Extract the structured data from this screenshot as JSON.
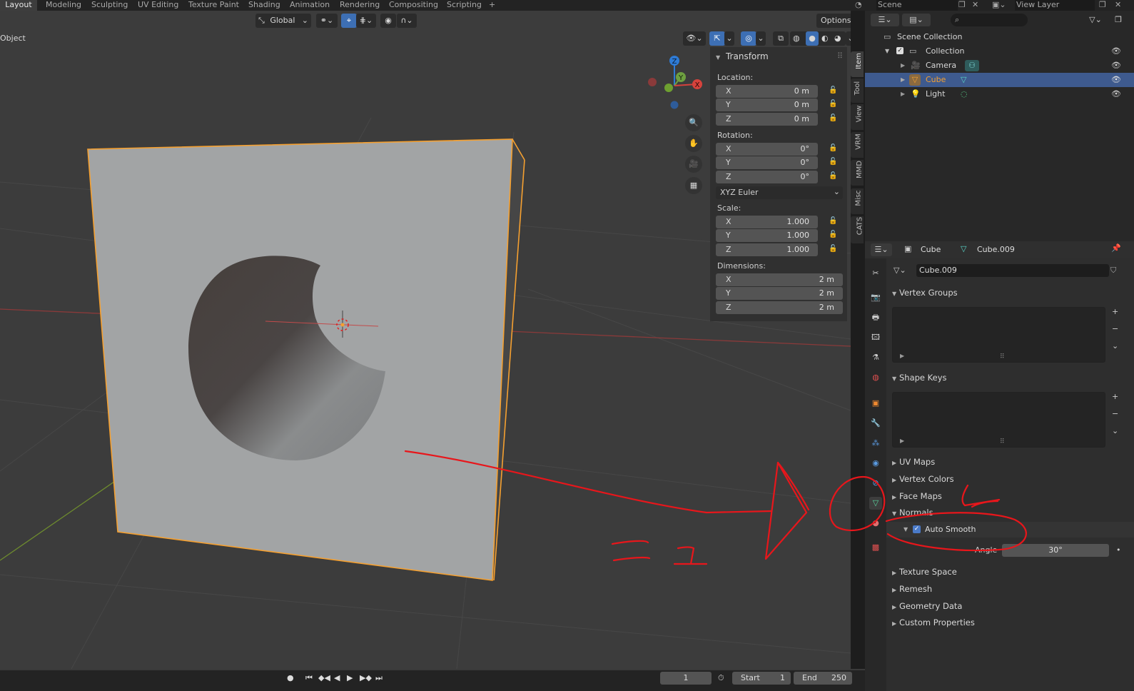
{
  "workspace_tabs": [
    "Layout",
    "Modeling",
    "Sculpting",
    "UV Editing",
    "Texture Paint",
    "Shading",
    "Animation",
    "Rendering",
    "Compositing",
    "Scripting"
  ],
  "add_tab_label": "+",
  "scene_label": "Scene",
  "view_layer_label": "View Layer",
  "viewport": {
    "mode_label": "Object",
    "orientation_label": "Global",
    "options_label": "Options",
    "gizmo_labels": {
      "z": "Z",
      "y": "Y",
      "x": "X"
    }
  },
  "npanel": {
    "title": "Transform",
    "location_label": "Location:",
    "location": [
      {
        "axis": "X",
        "value": "0 m"
      },
      {
        "axis": "Y",
        "value": "0 m"
      },
      {
        "axis": "Z",
        "value": "0 m"
      }
    ],
    "rotation_label": "Rotation:",
    "rotation": [
      {
        "axis": "X",
        "value": "0°"
      },
      {
        "axis": "Y",
        "value": "0°"
      },
      {
        "axis": "Z",
        "value": "0°"
      }
    ],
    "rotation_mode": "XYZ Euler",
    "scale_label": "Scale:",
    "scale": [
      {
        "axis": "X",
        "value": "1.000"
      },
      {
        "axis": "Y",
        "value": "1.000"
      },
      {
        "axis": "Z",
        "value": "1.000"
      }
    ],
    "dimensions_label": "Dimensions:",
    "dimensions": [
      {
        "axis": "X",
        "value": "2 m"
      },
      {
        "axis": "Y",
        "value": "2 m"
      },
      {
        "axis": "Z",
        "value": "2 m"
      }
    ],
    "side_tabs": [
      "Item",
      "Tool",
      "View",
      "VRM",
      "MMD",
      "Misc",
      "CATS"
    ]
  },
  "outliner": {
    "rows": [
      {
        "label": "Scene Collection"
      },
      {
        "label": "Collection"
      },
      {
        "label": "Camera"
      },
      {
        "label": "Cube"
      },
      {
        "label": "Light"
      }
    ]
  },
  "properties": {
    "object_name": "Cube",
    "mesh_name": "Cube.009",
    "datablock_name": "Cube.009",
    "sections": {
      "vertex_groups": "Vertex Groups",
      "shape_keys": "Shape Keys",
      "uv_maps": "UV Maps",
      "vertex_colors": "Vertex Colors",
      "face_maps": "Face Maps",
      "normals": "Normals",
      "auto_smooth": "Auto Smooth",
      "angle_label": "Angle",
      "angle_value": "30°",
      "texture_space": "Texture Space",
      "remesh": "Remesh",
      "geometry_data": "Geometry Data",
      "custom_properties": "Custom Properties"
    }
  },
  "timeline": {
    "current_frame": "1",
    "start_label": "Start",
    "start_value": "1",
    "end_label": "End",
    "end_value": "250"
  },
  "colors": {
    "accent": "#3d6fb4",
    "selected_outline": "#f5a030",
    "annotation": "#e8161b"
  }
}
